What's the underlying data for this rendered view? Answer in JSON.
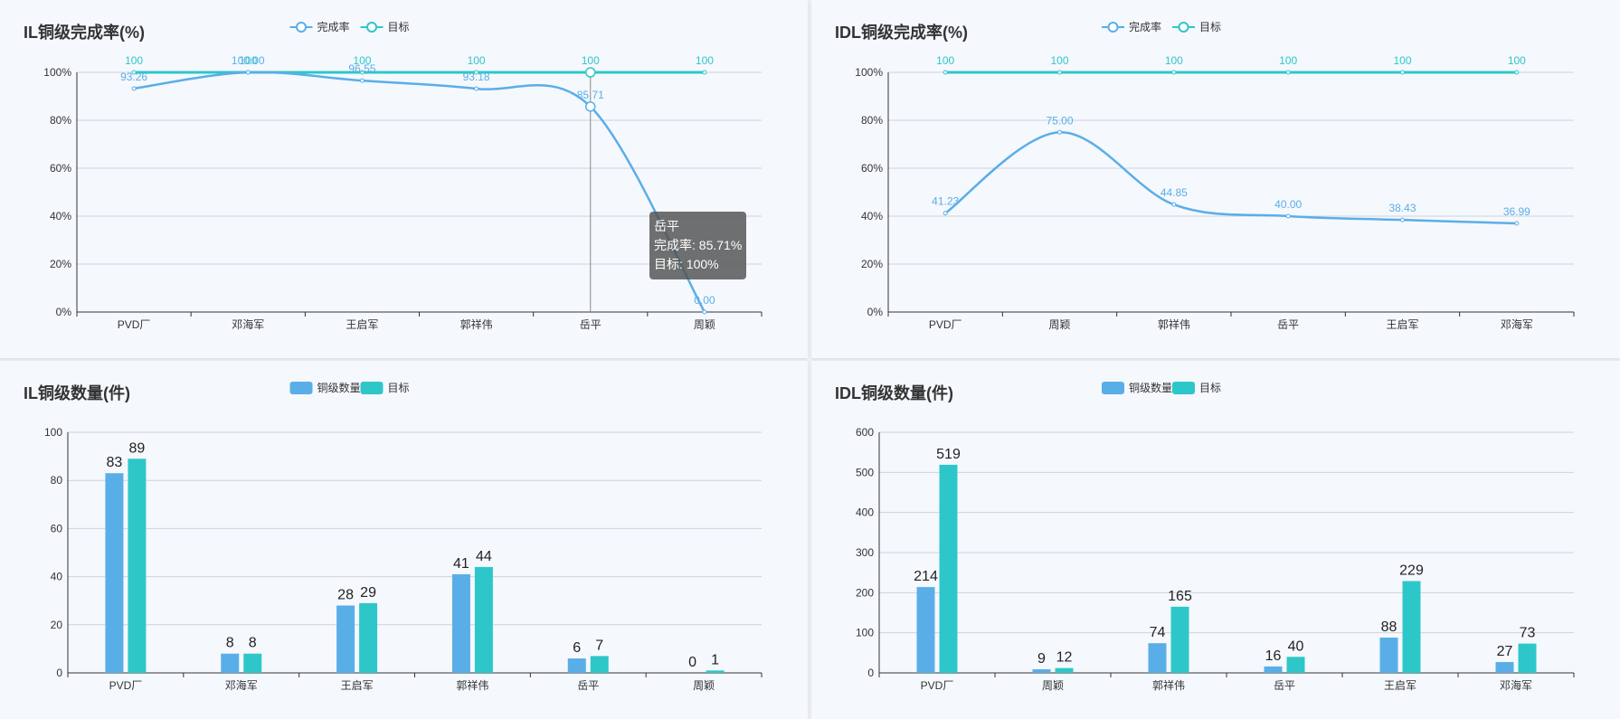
{
  "charts": [
    {
      "title": "IL铜级完成率(%)",
      "chart_data": {
        "type": "line",
        "categories": [
          "PVD厂",
          "邓海军",
          "王启军",
          "郭祥伟",
          "岳平",
          "周颖"
        ],
        "series": [
          {
            "name": "完成率",
            "values": [
              93.26,
              100.0,
              96.55,
              93.18,
              85.71,
              0.0
            ],
            "labels": [
              "93.26",
              "100.00",
              "96.55",
              "93.18",
              "85.71",
              "0.00"
            ],
            "color": "#5aaee8",
            "smooth": true
          },
          {
            "name": "目标",
            "values": [
              100,
              100,
              100,
              100,
              100,
              100
            ],
            "labels": [
              "100",
              "100",
              "100",
              "100",
              "100",
              "100"
            ],
            "color": "#2ec7c9",
            "smooth": false
          }
        ],
        "ylim": [
          0,
          100
        ],
        "yticks": [
          "0%",
          "20%",
          "40%",
          "60%",
          "80%",
          "100%"
        ],
        "grid": true,
        "legend": "top-center"
      },
      "tooltip": {
        "category": "岳平",
        "lines": [
          "完成率: 85.71%",
          "目标: 100%"
        ]
      }
    },
    {
      "title": "IDL铜级完成率(%)",
      "chart_data": {
        "type": "line",
        "categories": [
          "PVD厂",
          "周颖",
          "郭祥伟",
          "岳平",
          "王启军",
          "邓海军"
        ],
        "series": [
          {
            "name": "完成率",
            "values": [
              41.23,
              75.0,
              44.85,
              40.0,
              38.43,
              36.99
            ],
            "labels": [
              "41.23",
              "75.00",
              "44.85",
              "40.00",
              "38.43",
              "36.99"
            ],
            "color": "#5aaee8",
            "smooth": true
          },
          {
            "name": "目标",
            "values": [
              100,
              100,
              100,
              100,
              100,
              100
            ],
            "labels": [
              "100",
              "100",
              "100",
              "100",
              "100",
              "100"
            ],
            "color": "#2ec7c9",
            "smooth": false
          }
        ],
        "ylim": [
          0,
          100
        ],
        "yticks": [
          "0%",
          "20%",
          "40%",
          "60%",
          "80%",
          "100%"
        ],
        "grid": true,
        "legend": "top-center"
      }
    },
    {
      "title": "IL铜级数量(件)",
      "chart_data": {
        "type": "bar",
        "categories": [
          "PVD厂",
          "邓海军",
          "王启军",
          "郭祥伟",
          "岳平",
          "周颖"
        ],
        "series": [
          {
            "name": "铜级数量",
            "values": [
              83,
              8,
              28,
              41,
              6,
              0
            ],
            "color": "#5aaee8"
          },
          {
            "name": "目标",
            "values": [
              89,
              8,
              29,
              44,
              7,
              1
            ],
            "color": "#2ec7c9"
          }
        ],
        "ylim": [
          0,
          100
        ],
        "yticks": [
          "0",
          "20",
          "40",
          "60",
          "80",
          "100"
        ],
        "grid": true,
        "legend": "top-center"
      }
    },
    {
      "title": "IDL铜级数量(件)",
      "chart_data": {
        "type": "bar",
        "categories": [
          "PVD厂",
          "周颖",
          "郭祥伟",
          "岳平",
          "王启军",
          "邓海军"
        ],
        "series": [
          {
            "name": "铜级数量",
            "values": [
              214,
              9,
              74,
              16,
              88,
              27
            ],
            "color": "#5aaee8"
          },
          {
            "name": "目标",
            "values": [
              519,
              12,
              165,
              40,
              229,
              73
            ],
            "color": "#2ec7c9"
          }
        ],
        "ylim": [
          0,
          600
        ],
        "yticks": [
          "0",
          "100",
          "200",
          "300",
          "400",
          "500",
          "600"
        ],
        "grid": true,
        "legend": "top-center"
      }
    }
  ]
}
